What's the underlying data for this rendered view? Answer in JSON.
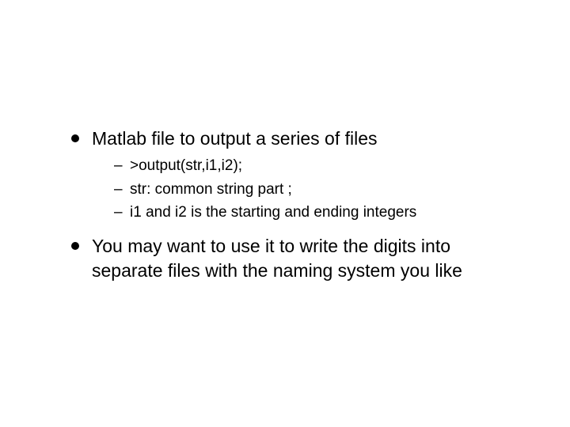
{
  "bullets": [
    {
      "text": "Matlab file to output a series of files",
      "sub": [
        ">output(str,i1,i2);",
        "str: common string part ;",
        "i1 and i2 is the starting and ending integers"
      ]
    },
    {
      "text": "You may want to use it to write the digits into separate files with the naming system you like",
      "sub": []
    }
  ]
}
